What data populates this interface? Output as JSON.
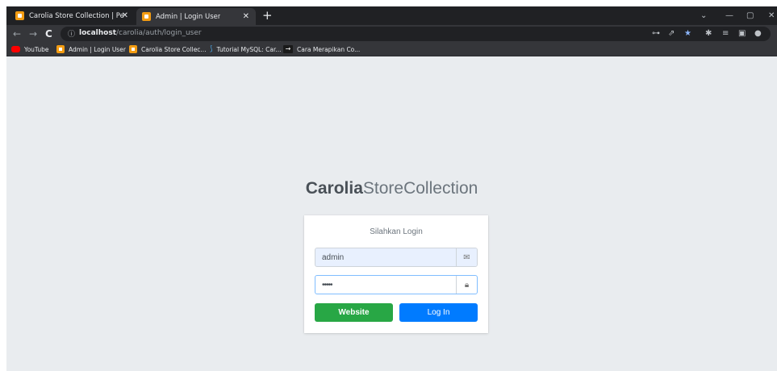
{
  "browser": {
    "tabs": [
      {
        "title": "Carolia Store Collection | Pesanan",
        "active": false
      },
      {
        "title": "Admin | Login User",
        "active": true
      }
    ],
    "new_tab_label": "+",
    "tab_close_glyph": "✕",
    "window_controls": {
      "dropdown": "⌄",
      "minimize": "—",
      "maximize": "▢",
      "close": "✕"
    },
    "nav": {
      "back": "←",
      "forward": "→",
      "reload": "C"
    },
    "address": {
      "host": "localhost",
      "path": "/carolia/auth/login_user"
    },
    "bookmarks": [
      {
        "label": "YouTube",
        "icon": "youtube-icon"
      },
      {
        "label": "Admin | Login User",
        "icon": "site-favicon-icon"
      },
      {
        "label": "Carolia Store Collec...",
        "icon": "site-favicon-icon"
      },
      {
        "label": "Tutorial MySQL: Car...",
        "icon": "mysql-icon"
      },
      {
        "label": "Cara Merapikan Co...",
        "icon": "arrow-icon"
      }
    ]
  },
  "login": {
    "logo_bold": "Carolia",
    "logo_light": "StoreCollection",
    "message": "Silahkan Login",
    "username_value": "admin",
    "password_value": "•••••",
    "website_button": "Website",
    "login_button": "Log In"
  },
  "colors": {
    "page_bg": "#e9ecef",
    "success": "#28a745",
    "primary": "#007bff",
    "autofill_bg": "#e8f0fe"
  }
}
